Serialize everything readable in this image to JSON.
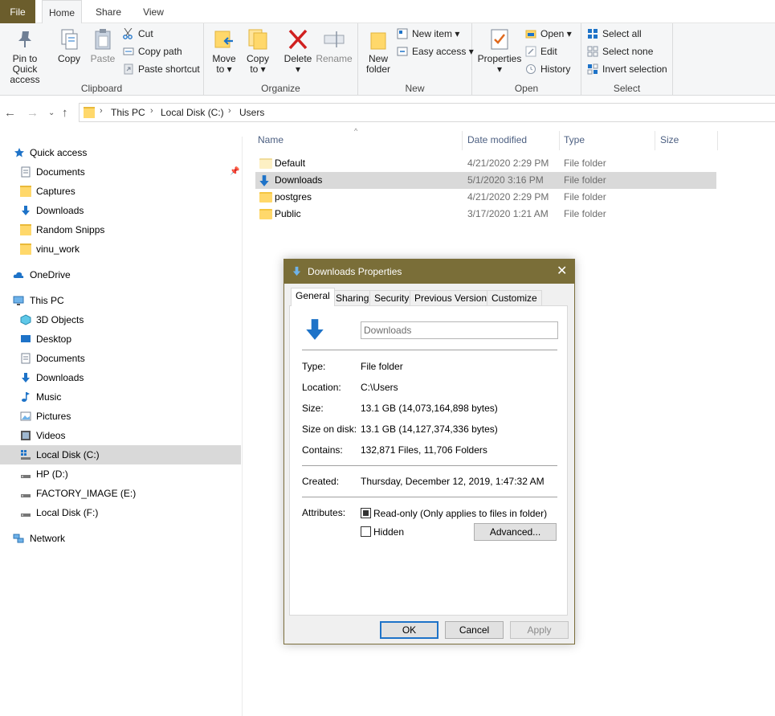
{
  "ribbon_tabs": {
    "file": "File",
    "home": "Home",
    "share": "Share",
    "view": "View"
  },
  "clipboard": {
    "pin": "Pin to Quick",
    "pin2": "access",
    "copy": "Copy",
    "paste": "Paste",
    "cut": "Cut",
    "copy_path": "Copy path",
    "paste_shortcut": "Paste shortcut",
    "label": "Clipboard"
  },
  "organize": {
    "move": "Move",
    "move2": "to",
    "copy": "Copy",
    "copy2": "to",
    "delete": "Delete",
    "rename": "Rename",
    "label": "Organize"
  },
  "new_group": {
    "new_folder": "New",
    "new_folder2": "folder",
    "new_item": "New item",
    "easy_access": "Easy access",
    "label": "New"
  },
  "open_group": {
    "properties": "Properties",
    "open": "Open",
    "edit": "Edit",
    "history": "History",
    "label": "Open"
  },
  "select_group": {
    "select_all": "Select all",
    "select_none": "Select none",
    "invert": "Invert selection",
    "label": "Select"
  },
  "breadcrumb": {
    "root": "This PC",
    "disk": "Local Disk (C:)",
    "folder": "Users"
  },
  "sidebar": {
    "quick_access": "Quick access",
    "qa_items": [
      "Documents",
      "Captures",
      "Downloads",
      "Random Snipps",
      "vinu_work"
    ],
    "onedrive": "OneDrive",
    "this_pc": "This PC",
    "pc_items": [
      "3D Objects",
      "Desktop",
      "Documents",
      "Downloads",
      "Music",
      "Pictures",
      "Videos",
      "Local Disk (C:)",
      "HP (D:)",
      "FACTORY_IMAGE (E:)",
      "Local Disk (F:)"
    ],
    "network": "Network"
  },
  "columns": {
    "name": "Name",
    "date": "Date modified",
    "type": "Type",
    "size": "Size"
  },
  "files": [
    {
      "name": "Default",
      "date": "4/21/2020 2:29 PM",
      "type": "File folder"
    },
    {
      "name": "Downloads",
      "date": "5/1/2020 3:16 PM",
      "type": "File folder"
    },
    {
      "name": "postgres",
      "date": "4/21/2020 2:29 PM",
      "type": "File folder"
    },
    {
      "name": "Public",
      "date": "3/17/2020 1:21 AM",
      "type": "File folder"
    }
  ],
  "dialog": {
    "title": "Downloads Properties",
    "tabs": [
      "General",
      "Sharing",
      "Security",
      "Previous Versions",
      "Customize"
    ],
    "name_value": "Downloads",
    "type_label": "Type:",
    "type_value": "File folder",
    "location_label": "Location:",
    "location_value": "C:\\Users",
    "size_label": "Size:",
    "size_value": "13.1 GB (14,073,164,898 bytes)",
    "size_disk_label": "Size on disk:",
    "size_disk_value": "13.1 GB (14,127,374,336 bytes)",
    "contains_label": "Contains:",
    "contains_value": "132,871 Files, 11,706 Folders",
    "created_label": "Created:",
    "created_value": "Thursday, December 12, 2019, 1:47:32 AM",
    "attributes_label": "Attributes:",
    "readonly": "Read-only (Only applies to files in folder)",
    "hidden": "Hidden",
    "advanced": "Advanced...",
    "ok": "OK",
    "cancel": "Cancel",
    "apply": "Apply"
  },
  "colors": {
    "title_bar": "#7a6e38",
    "file_tab": "#6b5d2c",
    "accent_blue": "#1e73c8"
  }
}
